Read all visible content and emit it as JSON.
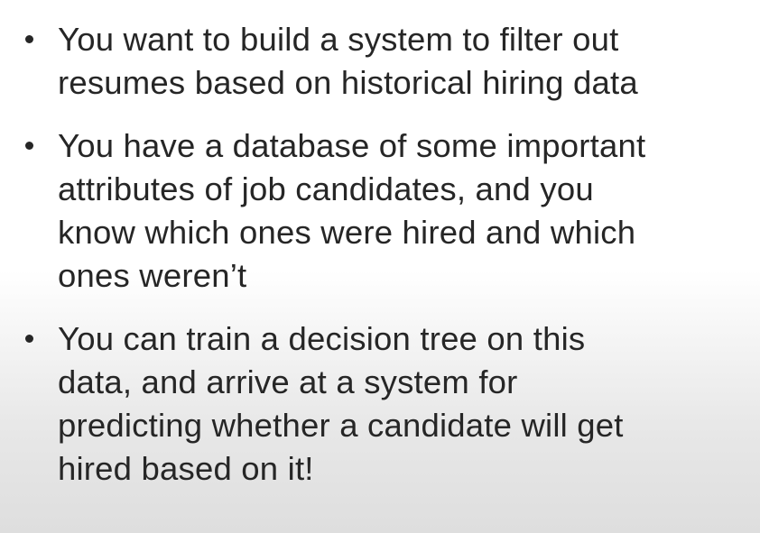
{
  "slide": {
    "bullets": [
      {
        "lines": [
          "You want to build a system to filter out",
          "resumes based on historical hiring data"
        ]
      },
      {
        "lines": [
          "You have a database of some important",
          "attributes of job candidates, and you",
          "know which ones were hired and which",
          "ones weren’t"
        ]
      },
      {
        "lines": [
          "You can train a decision tree on this",
          "data, and arrive at a system for",
          "predicting whether a candidate will get",
          "hired based on it!"
        ]
      }
    ]
  }
}
